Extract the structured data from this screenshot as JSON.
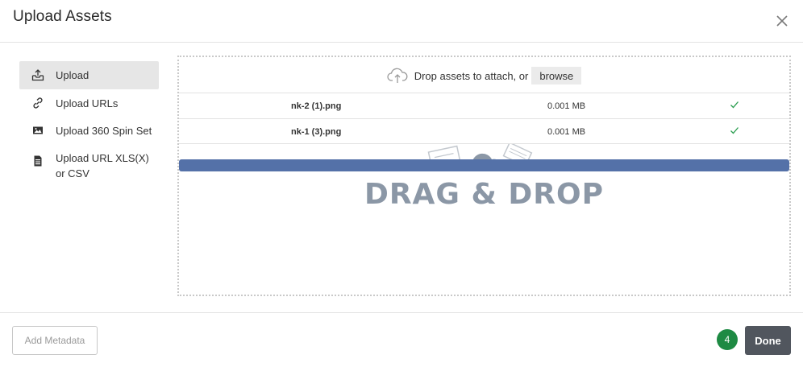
{
  "dialog": {
    "title": "Upload Assets"
  },
  "sidebar": {
    "items": [
      {
        "label": "Upload",
        "icon": "upload-tray-icon",
        "active": true
      },
      {
        "label": "Upload URLs",
        "icon": "link-icon",
        "active": false
      },
      {
        "label": "Upload 360 Spin Set",
        "icon": "image-icon",
        "active": false
      },
      {
        "label": "Upload URL XLS(X) or CSV",
        "icon": "spreadsheet-file-icon",
        "active": false
      }
    ]
  },
  "dropzone": {
    "prompt": "Drop assets to attach, or",
    "browse_label": "browse",
    "watermark": "DRAG & DROP",
    "files": [
      {
        "name": "nk-2 (1).png",
        "size": "0.001 MB",
        "status": "uploaded"
      },
      {
        "name": "nk-1 (3).png",
        "size": "0.001 MB",
        "status": "uploaded"
      }
    ],
    "progress": 1.0
  },
  "footer": {
    "metadata_label": "Add Metadata",
    "count": "4",
    "done_label": "Done"
  },
  "colors": {
    "progress": "#5471a8",
    "badge": "#1e8a43",
    "done_button": "#51565e",
    "check": "#2a9d4f"
  }
}
